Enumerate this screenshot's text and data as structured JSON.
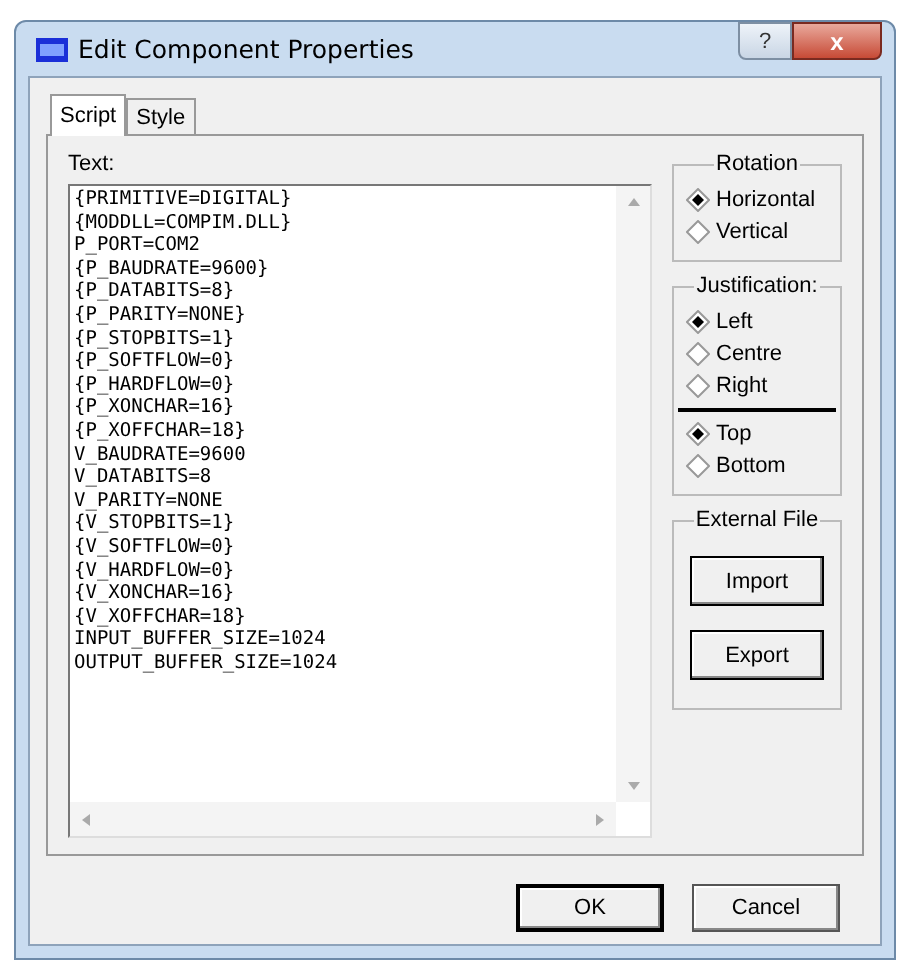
{
  "window": {
    "title": "Edit Component Properties",
    "help_button": "?",
    "close_button": "x"
  },
  "tabs": [
    {
      "label": "Script",
      "selected": true
    },
    {
      "label": "Style",
      "selected": false
    }
  ],
  "text_label": "Text:",
  "script_lines": [
    "{PRIMITIVE=DIGITAL}",
    "{MODDLL=COMPIM.DLL}",
    "P_PORT=COM2",
    "{P_BAUDRATE=9600}",
    "{P_DATABITS=8}",
    "{P_PARITY=NONE}",
    "{P_STOPBITS=1}",
    "{P_SOFTFLOW=0}",
    "{P_HARDFLOW=0}",
    "{P_XONCHAR=16}",
    "{P_XOFFCHAR=18}",
    "V_BAUDRATE=9600",
    "V_DATABITS=8",
    "V_PARITY=NONE",
    "{V_STOPBITS=1}",
    "{V_SOFTFLOW=0}",
    "{V_HARDFLOW=0}",
    "{V_XONCHAR=16}",
    "{V_XOFFCHAR=18}",
    "INPUT_BUFFER_SIZE=1024",
    "OUTPUT_BUFFER_SIZE=1024"
  ],
  "rotation": {
    "title": "Rotation",
    "options": [
      {
        "label": "Horizontal",
        "selected": true
      },
      {
        "label": "Vertical",
        "selected": false
      }
    ]
  },
  "justification": {
    "title": "Justification:",
    "horizontal": [
      {
        "label": "Left",
        "selected": true
      },
      {
        "label": "Centre",
        "selected": false
      },
      {
        "label": "Right",
        "selected": false
      }
    ],
    "vertical": [
      {
        "label": "Top",
        "selected": true
      },
      {
        "label": "Bottom",
        "selected": false
      }
    ]
  },
  "external_file": {
    "title": "External File",
    "buttons": [
      "Import",
      "Export"
    ]
  },
  "buttons": [
    {
      "label": "OK",
      "default": true
    },
    {
      "label": "Cancel",
      "default": false
    }
  ]
}
